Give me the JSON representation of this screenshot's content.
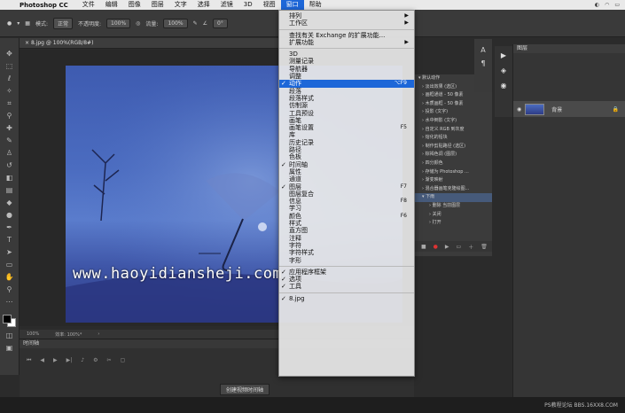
{
  "menubar": {
    "apple": "",
    "app": "Photoshop CC",
    "items": [
      "文件",
      "编辑",
      "图像",
      "图层",
      "文字",
      "选择",
      "滤镜",
      "3D",
      "视图",
      "窗口",
      "帮助"
    ],
    "active_index": 9
  },
  "optbar": {
    "mode_label": "模式:",
    "mode_value": "正常",
    "opacity_label": "不透明度:",
    "opacity_value": "100%",
    "flow_label": "流量:",
    "flow_value": "100%",
    "angle_value": "0°"
  },
  "document": {
    "tab": "8.jpg @ 100%(RGB/8#)",
    "watermark": "www.haoyidiansheji.com",
    "zoom": "100%",
    "doc_info": "效率: 100%*"
  },
  "timeline": {
    "title": "时间轴",
    "create_button": "创建视频时间轴"
  },
  "actions": {
    "rows": [
      {
        "label": "默认动作",
        "kind": "folder"
      },
      {
        "label": "淡出效果 (选区)",
        "kind": "item"
      },
      {
        "label": "画框通道 - 50 像素",
        "kind": "item"
      },
      {
        "label": "木质画框 - 50 像素",
        "kind": "item"
      },
      {
        "label": "投影 (文字)",
        "kind": "item"
      },
      {
        "label": "水中倒影 (文字)",
        "kind": "item"
      },
      {
        "label": "自定义 RGB 到灰度",
        "kind": "item"
      },
      {
        "label": "熔化的铅块",
        "kind": "item"
      },
      {
        "label": "制作剪贴路径 (选区)",
        "kind": "item"
      },
      {
        "label": "棕褐色调 (图层)",
        "kind": "item"
      },
      {
        "label": "四分颜色",
        "kind": "item"
      },
      {
        "label": "存储为 Photoshop ...",
        "kind": "item"
      },
      {
        "label": "渐变映射",
        "kind": "item"
      },
      {
        "label": "混合器画笔克隆绘图...",
        "kind": "item"
      },
      {
        "label": "下雨",
        "kind": "selected"
      },
      {
        "label": "删除 当前图层",
        "kind": "sub"
      },
      {
        "label": "关闭",
        "kind": "sub"
      },
      {
        "label": "打开",
        "kind": "sub"
      }
    ]
  },
  "layers": {
    "tab": "图层",
    "layer_name": "背景"
  },
  "footer_credit": "PS教程论坛 BBS.16XX8.COM",
  "menu": {
    "items": [
      {
        "label": "排列",
        "arrow": true
      },
      {
        "label": "工作区",
        "arrow": true
      },
      {
        "sep": true
      },
      {
        "label": "查找有关 Exchange 的扩展功能..."
      },
      {
        "label": "扩展功能",
        "arrow": true
      },
      {
        "sep": true
      },
      {
        "label": "3D"
      },
      {
        "label": "测量记录"
      },
      {
        "label": "导航器"
      },
      {
        "label": "调整"
      },
      {
        "label": "动作",
        "check": true,
        "shortcut": "⌥F9",
        "highlight": true
      },
      {
        "label": "段落"
      },
      {
        "label": "段落样式"
      },
      {
        "label": "仿制源"
      },
      {
        "label": "工具预设"
      },
      {
        "label": "画笔"
      },
      {
        "label": "画笔设置",
        "shortcut": "F5"
      },
      {
        "label": "库"
      },
      {
        "label": "历史记录"
      },
      {
        "label": "路径"
      },
      {
        "label": "色板"
      },
      {
        "label": "时间轴",
        "check": true
      },
      {
        "label": "属性"
      },
      {
        "label": "通道"
      },
      {
        "label": "图层",
        "check": true,
        "shortcut": "F7"
      },
      {
        "label": "图层复合"
      },
      {
        "label": "信息",
        "shortcut": "F8"
      },
      {
        "label": "学习"
      },
      {
        "label": "颜色",
        "shortcut": "F6"
      },
      {
        "label": "样式"
      },
      {
        "label": "直方图"
      },
      {
        "label": "注释"
      },
      {
        "label": "字符"
      },
      {
        "label": "字符样式"
      },
      {
        "label": "字形"
      },
      {
        "sep": true
      },
      {
        "label": "应用程序框架",
        "check": true
      },
      {
        "label": "选项",
        "check": true
      },
      {
        "label": "工具",
        "check": true
      },
      {
        "sep": true
      },
      {
        "label": "8.jpg",
        "check": true
      }
    ]
  }
}
